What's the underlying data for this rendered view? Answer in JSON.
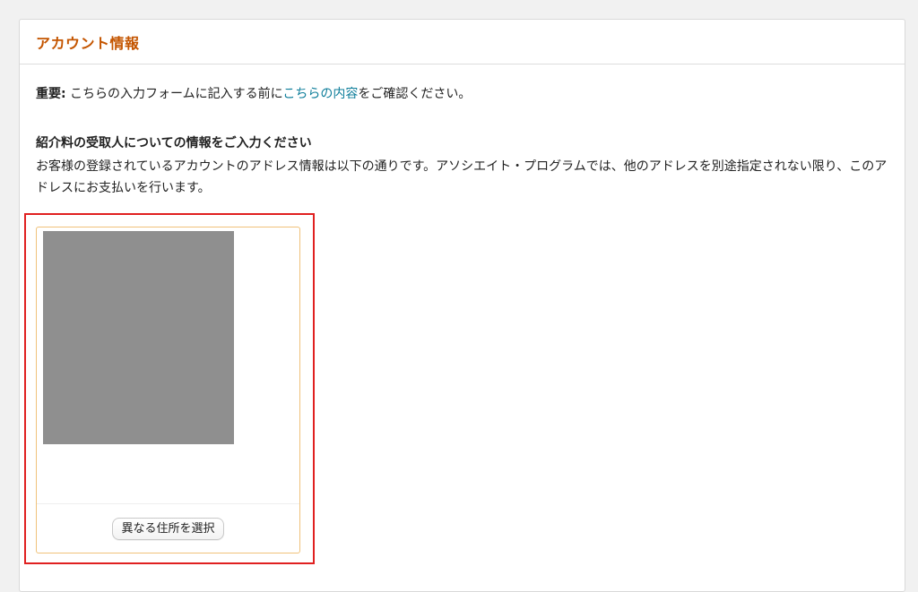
{
  "panel": {
    "title": "アカウント情報"
  },
  "notice": {
    "prefix": "重要:",
    "text_before_link": " こちらの入力フォームに記入する前に",
    "link_text": "こちらの内容",
    "text_after_link": "をご確認ください。"
  },
  "payee_section": {
    "heading": "紹介料の受取人についての情報をご入力ください",
    "description": "お客様の登録されているアカウントのアドレス情報は以下の通りです。アソシエイト・プログラムでは、他のアドレスを別途指定されない限り、このアドレスにお支払いを行います。"
  },
  "address_card": {
    "select_button_label": "異なる住所を選択"
  },
  "colors": {
    "accent_title": "#c45500",
    "link": "#0d7d9a",
    "highlight_border": "#e02020",
    "card_border": "#f0c27a",
    "redacted_fill": "#8f8f8f"
  }
}
